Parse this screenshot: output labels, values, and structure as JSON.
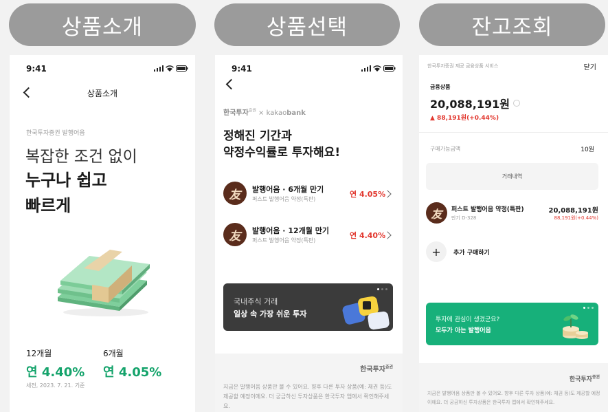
{
  "headers": [
    "상품소개",
    "상품선택",
    "잔고조회"
  ],
  "status_time": "9:41",
  "screen1": {
    "title": "상품소개",
    "issuer": "한국투자증권 발행어음",
    "headline1": "복잡한 조건 없이",
    "headline2": "누구나 쉽고",
    "headline3": "빠르게",
    "terms": [
      {
        "label": "12개월",
        "rate": "연 4.40%"
      },
      {
        "label": "6개월",
        "rate": "연 4.05%"
      }
    ],
    "note": "세전, 2023. 7. 21. 기준"
  },
  "screen2": {
    "brand_left": "한국투자",
    "brand_sup": "증권",
    "brand_x": "×",
    "brand_right_a": "kakao",
    "brand_right_b": "bank",
    "heading1": "정해진 기간과",
    "heading2": "약정수익률로 투자해요!",
    "products": [
      {
        "name": "발행어음 · 6개월 만기",
        "sub": "퍼스트 발행어음 약정(특판)",
        "rate": "연 4.05%",
        "logo": "友"
      },
      {
        "name": "발행어음 · 12개월 만기",
        "sub": "퍼스트 발행어음 약정(특판)",
        "rate": "연 4.40%",
        "logo": "友"
      }
    ],
    "banner_line1": "국내주식 거래",
    "banner_line2": "일상 속 가장 쉬운 투자",
    "footer_brand": "한국투자",
    "footer_sup": "증권",
    "footer_text": "지금은 발행어음 상품만 볼 수 있어요. 향후 다른 투자 상품(예: 채권 등)도 제공할 예정이에요. 더 궁금하신 투자상품은 한국투자 앱에서 확인해주세요."
  },
  "screen3": {
    "service": "한국투자증권 제공 금융상품 서비스",
    "close": "닫기",
    "section": "금융상품",
    "total": "20,088,191원",
    "change": "▲ 88,191원(+0.44%)",
    "buyable_label": "구매가능금액",
    "buyable_value": "10원",
    "history_button": "거래내역",
    "holding_name": "퍼스트 발행어음 약정(특판)",
    "holding_sub": "만기 D-328",
    "holding_amount": "20,088,191원",
    "holding_change": "88,191원(+0.44%)",
    "add_button": "추가 구매하기",
    "promo_line1": "투자에 관심이 생겼군요?",
    "promo_line2": "모두가 아는 발행어음",
    "footer_brand": "한국투자",
    "footer_sup": "증권",
    "footer_text": "지금은 발행어음 상품만 볼 수 있어요. 향후 다른 투자 상품(예: 채권 등)도 제공할 예정이에요. 더 궁금하신 투자상품은 한국투자 앱에서 확인해주세요."
  },
  "colors": {
    "accent_green": "#14a36b",
    "rate_red": "#e2382f",
    "promo_green": "#17b07a",
    "banner_dark": "#3b3b3b"
  }
}
